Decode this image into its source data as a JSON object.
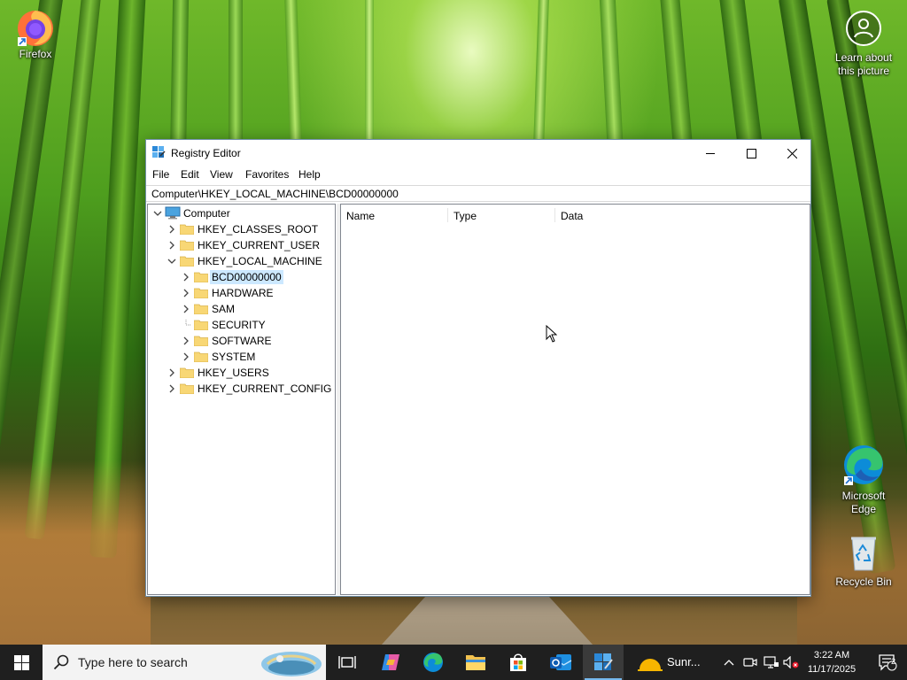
{
  "desktop": {
    "icons": [
      {
        "label": "Firefox"
      },
      {
        "label": "Learn about this picture"
      },
      {
        "label": "Microsoft Edge"
      },
      {
        "label": "Recycle Bin"
      }
    ]
  },
  "window": {
    "title": "Registry Editor",
    "menu": [
      "File",
      "Edit",
      "View",
      "Favorites",
      "Help"
    ],
    "address": "Computer\\HKEY_LOCAL_MACHINE\\BCD00000000",
    "tree": [
      {
        "label": "Computer",
        "state": "expanded",
        "selected": false
      },
      {
        "label": "HKEY_CLASSES_ROOT",
        "state": "collapsed",
        "selected": false
      },
      {
        "label": "HKEY_CURRENT_USER",
        "state": "collapsed",
        "selected": false
      },
      {
        "label": "HKEY_LOCAL_MACHINE",
        "state": "expanded",
        "selected": false
      },
      {
        "label": "BCD00000000",
        "state": "collapsed",
        "selected": true
      },
      {
        "label": "HARDWARE",
        "state": "collapsed",
        "selected": false
      },
      {
        "label": "SAM",
        "state": "collapsed",
        "selected": false
      },
      {
        "label": "SECURITY",
        "state": "leaf",
        "selected": false
      },
      {
        "label": "SOFTWARE",
        "state": "collapsed",
        "selected": false
      },
      {
        "label": "SYSTEM",
        "state": "collapsed",
        "selected": false
      },
      {
        "label": "HKEY_USERS",
        "state": "collapsed",
        "selected": false
      },
      {
        "label": "HKEY_CURRENT_CONFIG",
        "state": "collapsed",
        "selected": false
      }
    ],
    "columns": [
      "Name",
      "Type",
      "Data"
    ]
  },
  "taskbar": {
    "search_placeholder": "Type here to search",
    "weather_text": "Sunr...",
    "time": "3:22 AM",
    "date": "11/17/2025",
    "notification_count": "2",
    "accent_color": "#76b9ed"
  },
  "colors": {
    "selection": "#cce8ff",
    "folder": "#f8d775",
    "window_border": "#6f8fa8"
  }
}
